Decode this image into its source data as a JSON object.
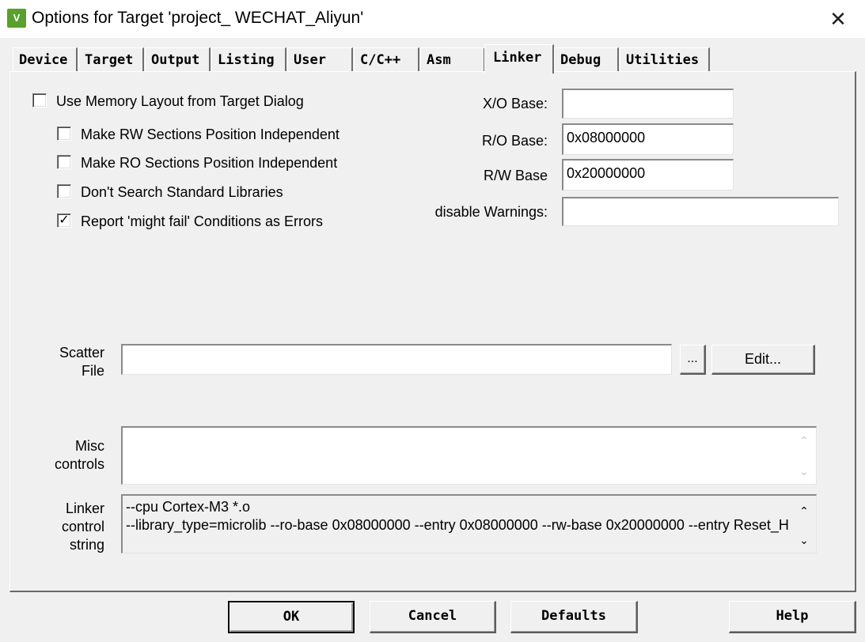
{
  "window": {
    "icon": "keil-uvision-icon",
    "title": "Options for Target 'project_ WECHAT_Aliyun'",
    "close_glyph": "✕"
  },
  "tabs": [
    "Device",
    "Target",
    "Output",
    "Listing",
    "User",
    "C/C++",
    "Asm",
    "Linker",
    "Debug",
    "Utilities"
  ],
  "active_tab": "Linker",
  "options": {
    "use_memory_layout": {
      "label": "Use Memory Layout from Target Dialog",
      "checked": false
    },
    "rw_position_independent": {
      "label": "Make RW Sections Position Independent",
      "checked": false
    },
    "ro_position_independent": {
      "label": "Make RO Sections Position Independent",
      "checked": false
    },
    "dont_search_std_libs": {
      "label": "Don't Search Standard Libraries",
      "checked": false
    },
    "report_might_fail": {
      "label": "Report 'might fail' Conditions as Errors",
      "checked": true,
      "mark": "✓"
    }
  },
  "bases": {
    "xo_label": "X/O Base:",
    "xo_value": "",
    "ro_label": "R/O Base:",
    "ro_value": "0x08000000",
    "rw_label": "R/W Base",
    "rw_value": "0x20000000",
    "warnings_label": "disable Warnings:",
    "warnings_value": ""
  },
  "scatter": {
    "label_line1": "Scatter",
    "label_line2": "File",
    "value": "",
    "browse_label": "...",
    "edit_label": "Edit..."
  },
  "misc": {
    "label_line1": "Misc",
    "label_line2": "controls",
    "value": "",
    "scroll_up": "⌃",
    "scroll_down": "⌄"
  },
  "linker_control": {
    "label_line1": "Linker",
    "label_line2": "control",
    "label_line3": "string",
    "line1": "--cpu Cortex-M3 *.o",
    "line2": "--library_type=microlib --ro-base 0x08000000 --entry 0x08000000 --rw-base 0x20000000 --entry Reset_H",
    "scroll_up": "⌃",
    "scroll_down": "⌄"
  },
  "buttons": {
    "ok": "OK",
    "cancel": "Cancel",
    "defaults": "Defaults",
    "help": "Help"
  }
}
